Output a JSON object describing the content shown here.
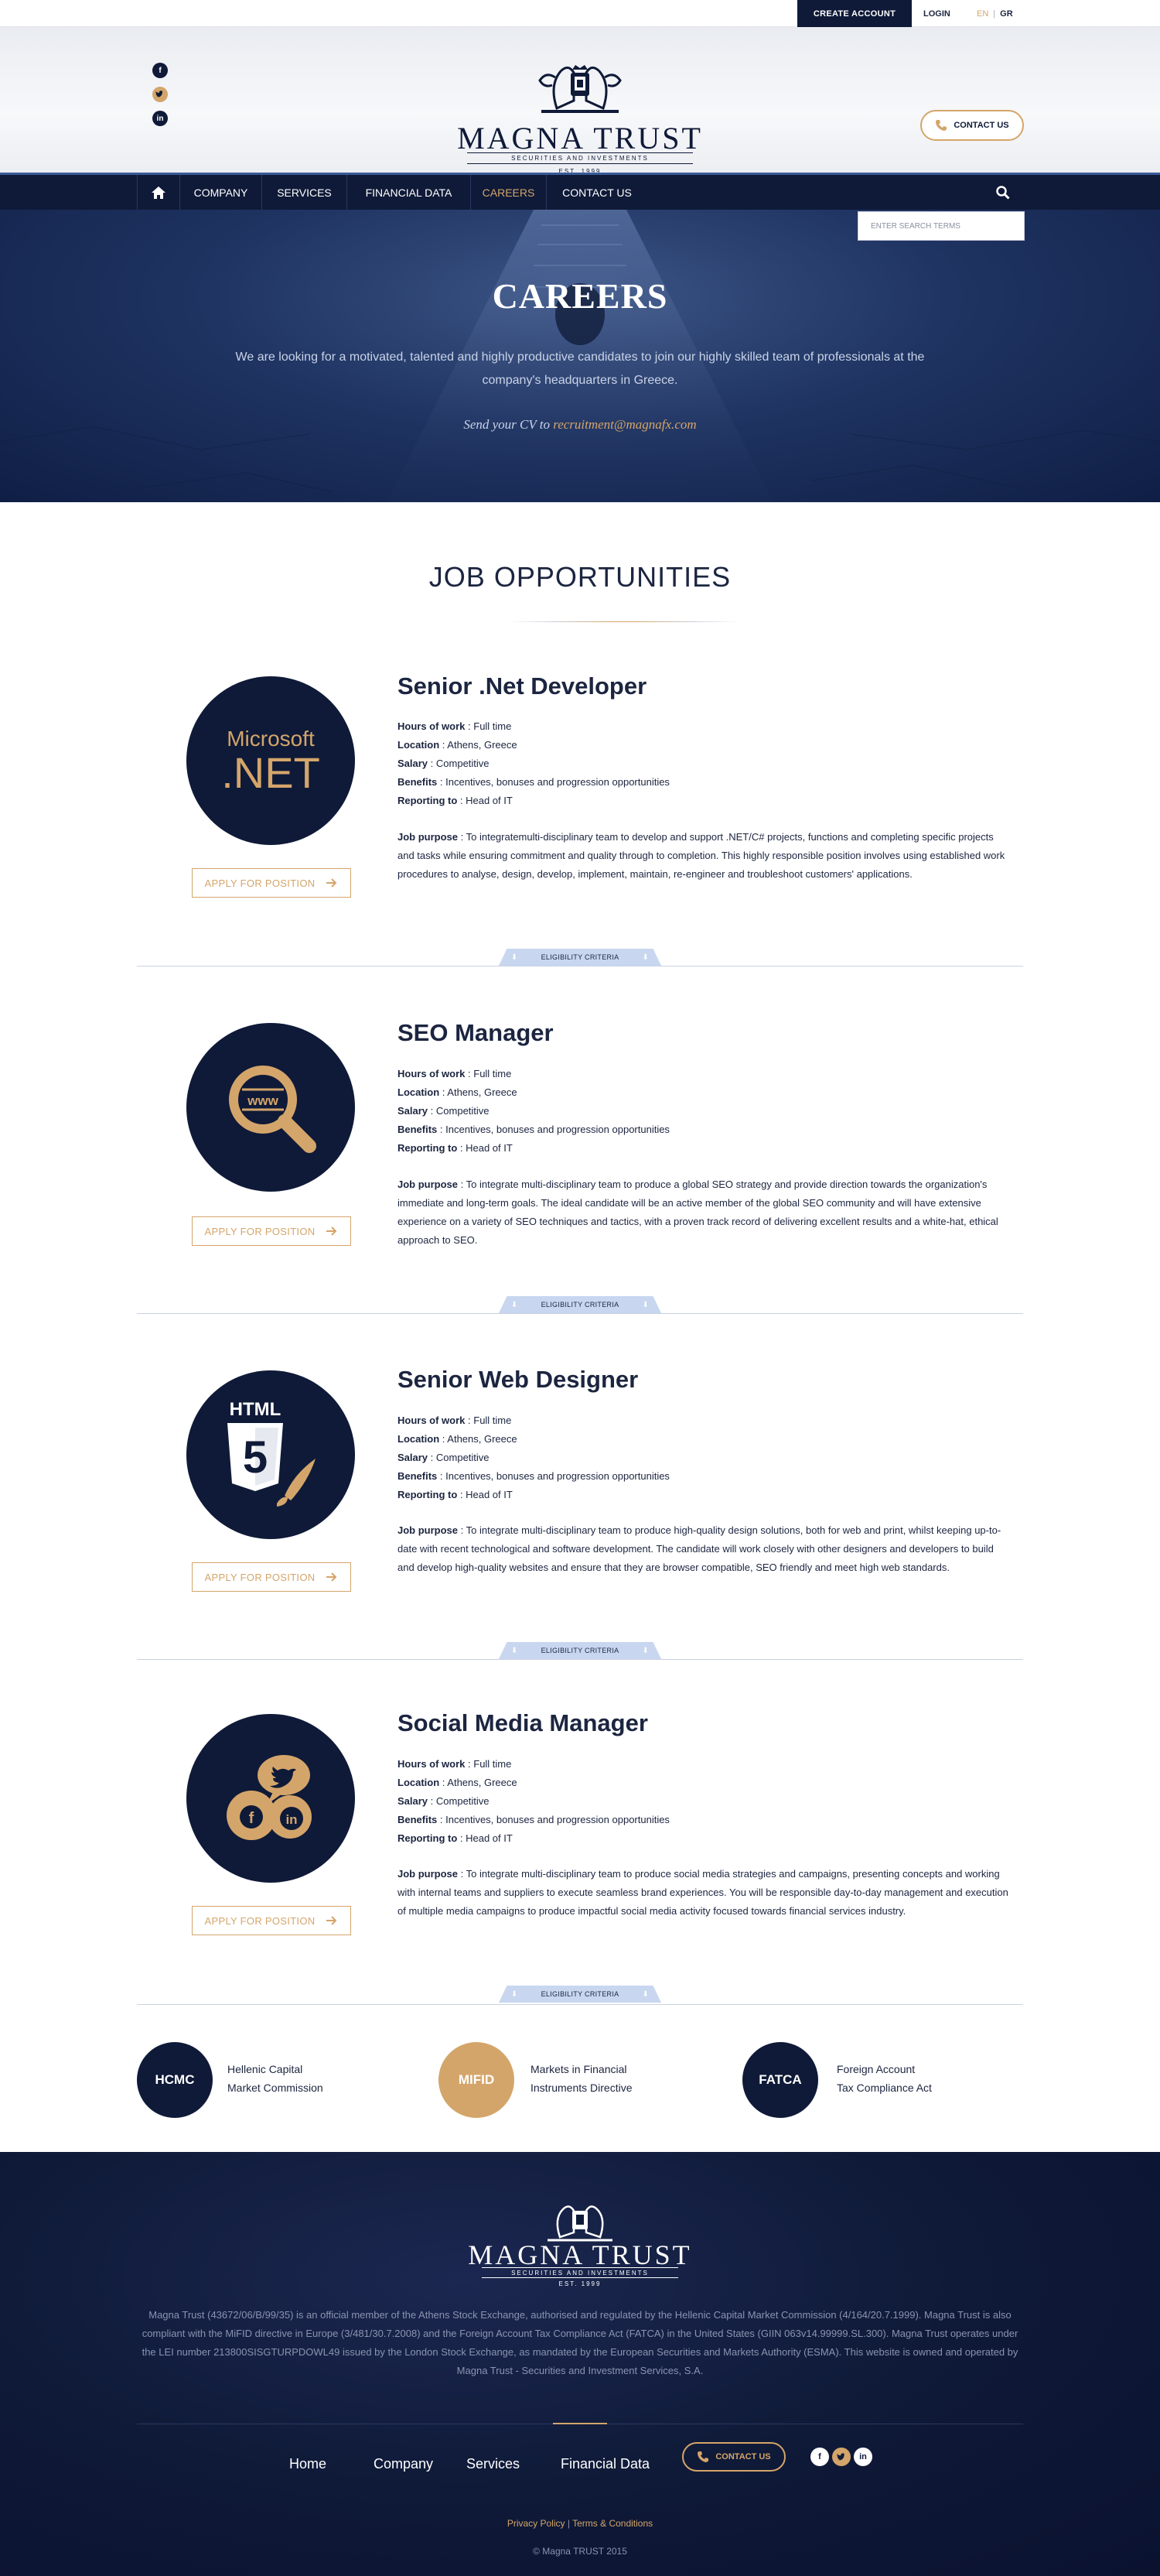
{
  "topbar": {
    "create_account": "CREATE ACCOUNT",
    "login": "LOGIN",
    "lang_en": "EN",
    "lang_sep": "|",
    "lang_gr": "GR"
  },
  "header": {
    "social": [
      "facebook-icon",
      "twitter-icon",
      "linkedin-icon"
    ],
    "logo_title": "MAGNA TRUST",
    "logo_sub": "SECURITIES AND INVESTMENTS",
    "logo_est": "EST. 1999",
    "contact_label": "CONTACT US"
  },
  "nav": {
    "items": [
      "COMPANY",
      "SERVICES",
      "FINANCIAL DATA",
      "CAREERS",
      "CONTACT US"
    ],
    "active": "CAREERS",
    "search_placeholder": "ENTER SEARCH TERMS"
  },
  "hero": {
    "title": "CAREERS",
    "text": "We are looking for a motivated, talented and highly productive candidates to join our highly skilled team of professionals at the company's headquarters in Greece.",
    "cv_prefix": "Send your CV to ",
    "cv_email": "recruitment@magnafx.com"
  },
  "jobs_title": "JOB OPPORTUNITIES",
  "labels": {
    "hours": "Hours of work",
    "location": "Location",
    "salary": "Salary",
    "benefits": "Benefits",
    "reporting": "Reporting to",
    "purpose": "Job purpose",
    "colon": " : ",
    "apply": "APPLY FOR POSITION",
    "eligibility": "ELIGIBILITY CRITERIA"
  },
  "jobs": [
    {
      "title": "Senior .Net Developer",
      "icon": "dotnet-icon",
      "icon_text_top": "Microsoft",
      "icon_text_main": ".NET",
      "hours": "Full time",
      "location": "Athens, Greece",
      "salary": "Competitive",
      "benefits": "Incentives, bonuses and progression opportunities",
      "reporting": "Head of IT",
      "purpose": "To integratemulti-disciplinary team to develop and support .NET/C# projects, functions and completing specific projects and tasks while ensuring commitment and quality through to completion. This highly responsible position involves using established work procedures to analyse, design, develop, implement, maintain, re-engineer and troubleshoot customers' applications."
    },
    {
      "title": "SEO Manager",
      "icon": "magnifier-www-icon",
      "icon_text_main": "www",
      "hours": "Full time",
      "location": "Athens, Greece",
      "salary": "Competitive",
      "benefits": "Incentives, bonuses and progression opportunities",
      "reporting": "Head of IT",
      "purpose": "To integrate multi-disciplinary team to produce a global SEO strategy and provide direction towards the organization's immediate and long-term goals. The ideal candidate will be an active member of the global SEO community and will have extensive experience on a variety of SEO techniques and tactics, with a proven track record of delivering excellent results and a white-hat, ethical approach to SEO."
    },
    {
      "title": "Senior Web Designer",
      "icon": "html5-icon",
      "icon_text_top": "HTML",
      "icon_text_main": "5",
      "hours": "Full time",
      "location": "Athens, Greece",
      "salary": "Competitive",
      "benefits": "Incentives, bonuses and progression opportunities",
      "reporting": "Head of IT",
      "purpose": "To integrate multi-disciplinary team to produce high-quality design solutions, both for web and print, whilst keeping up-to-date with recent technological and software development. The candidate will work closely with other designers and developers to build and develop high-quality websites and ensure that they are browser compatible, SEO friendly and meet high web standards."
    },
    {
      "title": "Social Media Manager",
      "icon": "social-bubbles-icon",
      "hours": "Full time",
      "location": "Athens, Greece",
      "salary": "Competitive",
      "benefits": "Incentives, bonuses and progression opportunities",
      "reporting": "Head of IT",
      "purpose": "To integrate multi-disciplinary team to produce social media strategies and campaigns, presenting concepts and working with internal teams and suppliers to execute seamless brand experiences. You will be responsible day-to-day management and execution of multiple media campaigns to produce impactful social media activity focused towards financial services industry."
    }
  ],
  "compliance": [
    {
      "abbr": "HCMC",
      "line1": "Hellenic Capital",
      "line2": "Market Commission",
      "color": "#0f1a38"
    },
    {
      "abbr": "MIFID",
      "line1": "Markets in Financial",
      "line2": "Instruments Directive",
      "color": "#d4a56a"
    },
    {
      "abbr": "FATCA",
      "line1": "Foreign Account",
      "line2": "Tax Compliance Act",
      "color": "#0f1a38"
    }
  ],
  "footer": {
    "logo_title": "MAGNA TRUST",
    "logo_sub": "SECURITIES AND INVESTMENTS",
    "logo_est": "EST. 1999",
    "text": "Magna Trust (43672/06/B/99/35) is an official member of the Athens Stock Exchange, authorised and regulated by the Hellenic Capital Market Commission (4/164/20.7.1999). Magna Trust is also compliant with the MiFID directive in Europe (3/481/30.7.2008) and the Foreign Account Tax Compliance Act (FATCA) in the United States (GIIN 063v14.99999.SL.300). Magna Trust operates under the LEI number 213800SISGTURPDOWL49 issued by the London Stock Exchange, as mandated by the European Securities and Markets Authority (ESMA). This website is owned and operated by Magna Trust - Securities and Investment Services, S.A.",
    "links": [
      "Home",
      "Company",
      "Services",
      "Financial Data"
    ],
    "contact_label": "CONTACT US",
    "privacy": "Privacy Policy",
    "legal_sep": "|",
    "terms": "Terms & Conditions",
    "copyright": "© Magna TRUST 2015"
  },
  "colors": {
    "navy": "#0f1a38",
    "gold": "#d4a56a",
    "eligibility": "#c8d7ef"
  }
}
